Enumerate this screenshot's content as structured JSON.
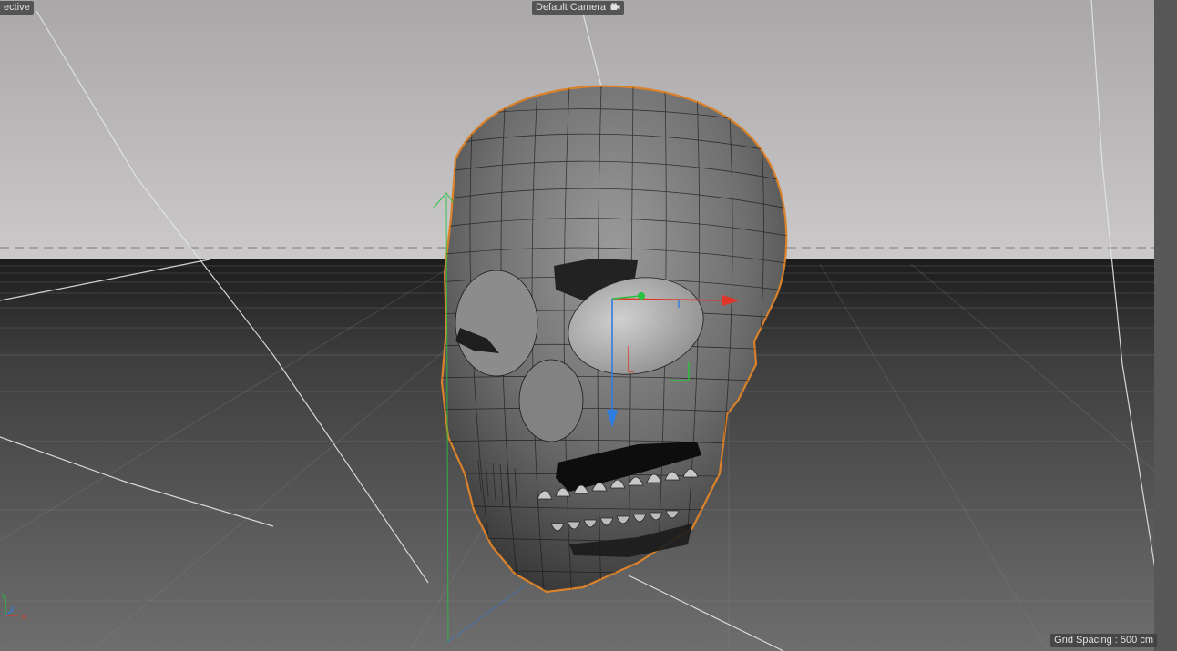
{
  "viewport": {
    "view_name": "ective",
    "camera_name": "Default Camera",
    "grid_spacing_label": "Grid Spacing : 500 cm"
  },
  "icons": {
    "camera": "camera-icon",
    "axis": "world-axis-indicator-icon",
    "gizmo": "move-gizmo-icon"
  },
  "colors": {
    "sky_top": "#aba9aa",
    "sky_bottom": "#c9c7c8",
    "floor": "#555555",
    "selection_outline": "#d9822b",
    "axis_x": "#e0352a",
    "axis_y": "#27c23e",
    "axis_z": "#2e7de0"
  }
}
